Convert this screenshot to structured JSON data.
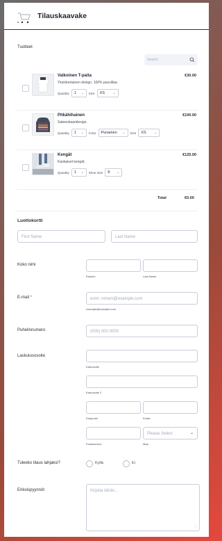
{
  "form": {
    "title": "Tilauskaavake"
  },
  "products": {
    "section_label": "Tuotteet",
    "search_placeholder": "Search",
    "items": [
      {
        "name": "Valkoinen T-paita",
        "description": "Yksinkertainen design. 100% puuvillaa.",
        "price": "€30.00",
        "options": [
          {
            "label": "Quantity",
            "value": "1"
          },
          {
            "label": "Size",
            "value": "XS"
          }
        ]
      },
      {
        "name": "Pitkähihainen",
        "description": "Sateenkaaridesign.",
        "price": "€100.00",
        "options": [
          {
            "label": "Quantity",
            "value": "1"
          },
          {
            "label": "Color",
            "value": "Punainen"
          },
          {
            "label": "Size",
            "value": "XS"
          }
        ]
      },
      {
        "name": "Kengät",
        "description": "Kankaiset kengät.",
        "price": "€125.00",
        "options": [
          {
            "label": "Quantity",
            "value": "1"
          },
          {
            "label": "Shoe Size",
            "value": "8"
          }
        ]
      }
    ],
    "total_label": "Total",
    "total_value": "€0.00"
  },
  "credit_card": {
    "heading": "Luottokortti",
    "first_name_placeholder": "First Name",
    "last_name_placeholder": "Last Name"
  },
  "full_name": {
    "label": "Koko nimi",
    "first_sub": "Etunimi",
    "last_sub": "Last Name"
  },
  "email": {
    "label": "E-mail",
    "required_mark": "*",
    "placeholder": "esim: nimeni@example.com",
    "sub": "example@example.com"
  },
  "phone": {
    "label": "Puhelinnumero",
    "placeholder": "(000) 000-0000"
  },
  "address": {
    "label": "Laskutusosoite",
    "street_sub": "Katuosoite",
    "street2_sub": "Katuosoite 2",
    "city_sub": "Kaupunki",
    "region_sub": "Kunta",
    "zip_sub": "Postinumero",
    "country_sub": "Maa",
    "country_placeholder": "Please Select"
  },
  "gift": {
    "label": "Tuleeko tilaus lahjaksi?",
    "yes": "Kyllä",
    "no": "Ei"
  },
  "special": {
    "label": "Erikoispyynnöt",
    "placeholder": "Kirjoita tähän..."
  },
  "colors": {
    "header_line": "#2c3345",
    "accent": "#e0433a"
  }
}
